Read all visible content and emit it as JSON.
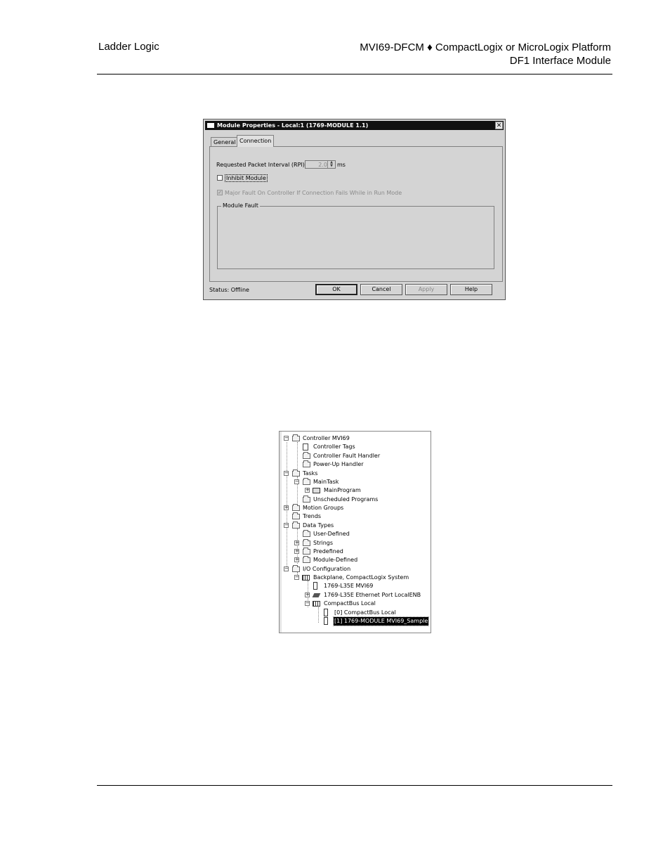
{
  "header": {
    "left": "Ladder Logic",
    "right_line1": "MVI69-DFCM ♦ CompactLogix or MicroLogix Platform",
    "right_line2": "DF1 Interface Module"
  },
  "dialog": {
    "title": "Module Properties  - Local:1 (1769-MODULE 1.1)",
    "close": "✕",
    "tabs": [
      "General",
      "Connection"
    ],
    "rpi_label": "Requested Packet Interval (RPI):",
    "rpi_value": "2.0",
    "rpi_unit": "ms",
    "inhibit_label": "Inhibit Module",
    "inhibit_checked": false,
    "major_fault_label": "Major Fault On Controller If Connection Fails While in Run Mode",
    "major_fault_checked": true,
    "module_fault_label": "Module Fault",
    "status": "Status:  Offline",
    "buttons": {
      "ok": "OK",
      "cancel": "Cancel",
      "apply": "Apply",
      "help": "Help"
    }
  },
  "tree": {
    "items": [
      "Controller MVI69",
      "Controller Tags",
      "Controller Fault Handler",
      "Power-Up Handler",
      "Tasks",
      "MainTask",
      "MainProgram",
      "Unscheduled Programs",
      "Motion Groups",
      "Trends",
      "Data Types",
      "User-Defined",
      "Strings",
      "Predefined",
      "Module-Defined",
      "I/O Configuration",
      "Backplane, CompactLogix System",
      "1769-L35E MVI69",
      "1769-L35E Ethernet Port LocalENB",
      "CompactBus Local",
      "[0] CompactBus Local",
      "[1] 1769-MODULE MVI69_Sample"
    ],
    "expand_minus": "−",
    "expand_plus": "+"
  }
}
